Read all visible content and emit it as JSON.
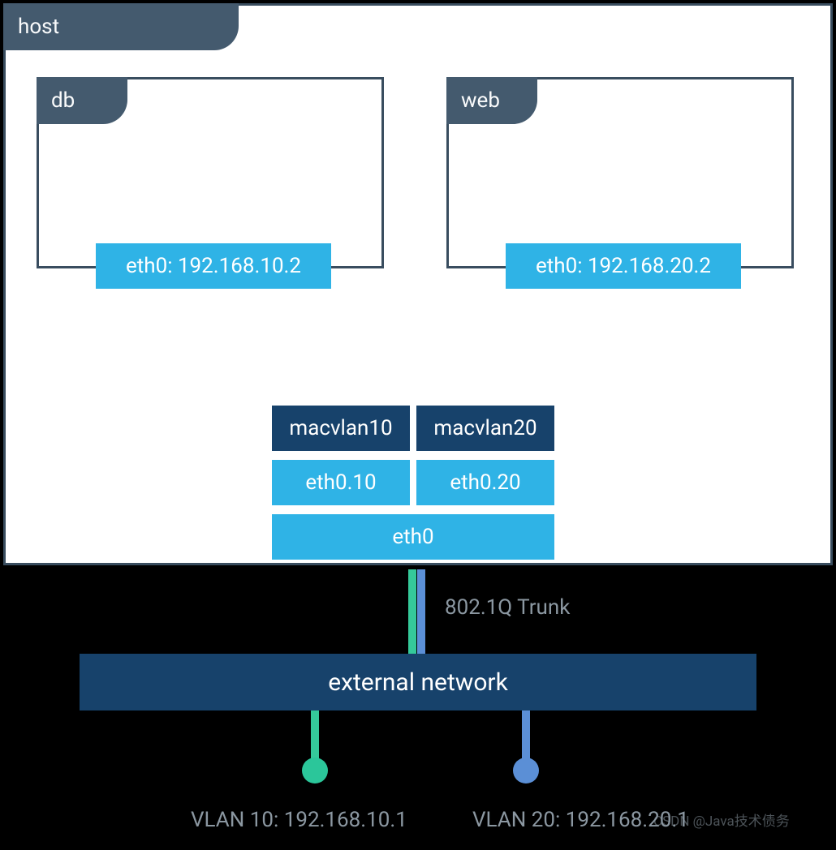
{
  "host": {
    "label": "host"
  },
  "containers": {
    "db": {
      "label": "db",
      "iface": "eth0: 192.168.10.2"
    },
    "web": {
      "label": "web",
      "iface": "eth0: 192.168.20.2"
    }
  },
  "networks": {
    "macvlan10": "macvlan10",
    "macvlan20": "macvlan20",
    "sub10": "eth0.10",
    "sub20": "eth0.20",
    "eth0": "eth0"
  },
  "trunk_label": "802.1Q Trunk",
  "external": {
    "label": "external network"
  },
  "vlans": {
    "v10": "VLAN 10: 192.168.10.1",
    "v20": "VLAN 20: 192.168.20.1"
  },
  "watermark": "CSDN @Java技术债务",
  "colors": {
    "green": "#35c99a",
    "blue": "#5b8fd6",
    "cyan": "#2fb3e6",
    "dark": "#17426b",
    "slate": "#445a6e"
  }
}
